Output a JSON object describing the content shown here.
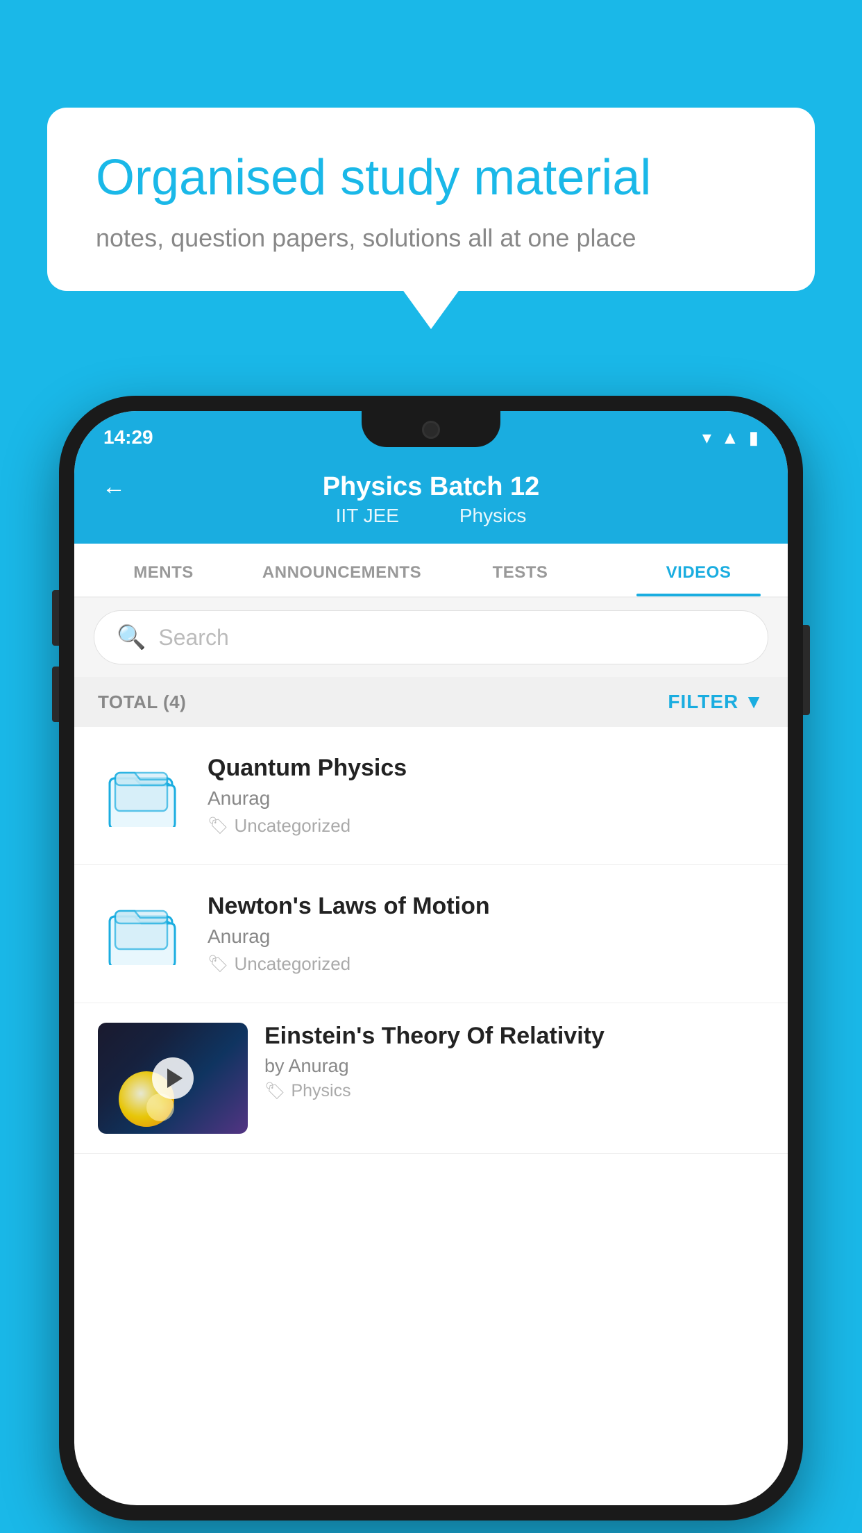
{
  "bubble": {
    "title": "Organised study material",
    "subtitle": "notes, question papers, solutions all at one place"
  },
  "statusBar": {
    "time": "14:29"
  },
  "header": {
    "title": "Physics Batch 12",
    "subtitle1": "IIT JEE",
    "subtitle2": "Physics"
  },
  "tabs": [
    {
      "label": "MENTS",
      "active": false
    },
    {
      "label": "ANNOUNCEMENTS",
      "active": false
    },
    {
      "label": "TESTS",
      "active": false
    },
    {
      "label": "VIDEOS",
      "active": true
    }
  ],
  "search": {
    "placeholder": "Search"
  },
  "filterBar": {
    "total": "TOTAL (4)",
    "filter": "FILTER"
  },
  "videos": [
    {
      "title": "Quantum Physics",
      "author": "Anurag",
      "tag": "Uncategorized",
      "hasThumb": false
    },
    {
      "title": "Newton's Laws of Motion",
      "author": "Anurag",
      "tag": "Uncategorized",
      "hasThumb": false
    },
    {
      "title": "Einstein's Theory Of Relativity",
      "author": "by Anurag",
      "tag": "Physics",
      "hasThumb": true
    }
  ]
}
